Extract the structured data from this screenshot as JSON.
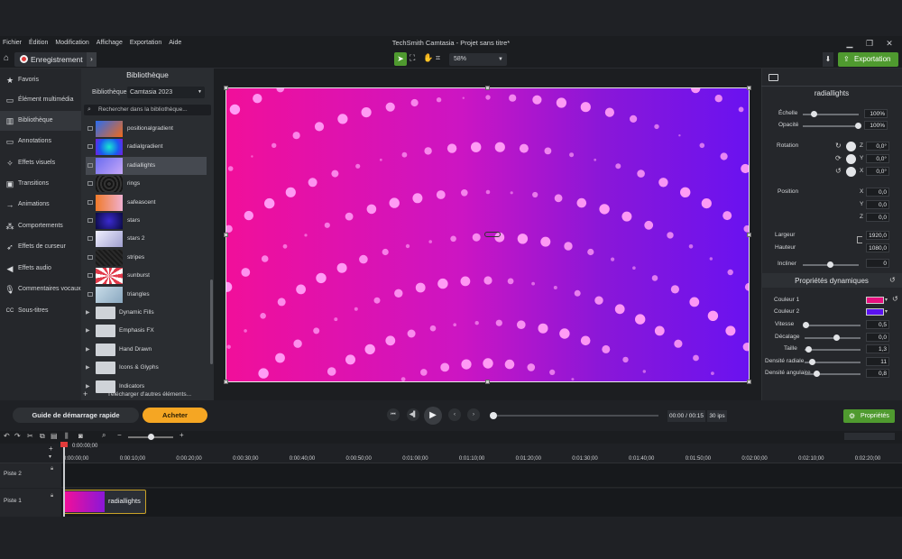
{
  "menubar": {
    "items": [
      "Fichier",
      "Édition",
      "Modification",
      "Affichage",
      "Exportation",
      "Aide"
    ],
    "app_title": "TechSmith Camtasia - Projet sans titre*"
  },
  "toolbar": {
    "record_label": "Enregistrement",
    "zoom_value": "58%",
    "export_label": "Exportation"
  },
  "nav": {
    "items": [
      {
        "label": "Favoris",
        "icon": "star-icon"
      },
      {
        "label": "Élément multimédia",
        "icon": "media-icon"
      },
      {
        "label": "Bibliothèque",
        "icon": "library-icon",
        "active": true
      },
      {
        "label": "Annotations",
        "icon": "annotation-icon"
      },
      {
        "label": "Effets visuels",
        "icon": "effects-icon"
      },
      {
        "label": "Transitions",
        "icon": "transition-icon"
      },
      {
        "label": "Animations",
        "icon": "animation-icon"
      },
      {
        "label": "Comportements",
        "icon": "behavior-icon"
      },
      {
        "label": "Effets de curseur",
        "icon": "cursor-icon"
      },
      {
        "label": "Effets audio",
        "icon": "audio-icon"
      },
      {
        "label": "Commentaires vocaux",
        "icon": "mic-icon"
      },
      {
        "label": "Sous-titres",
        "icon": "cc-icon"
      }
    ]
  },
  "library": {
    "title": "Bibliothèque",
    "select_label": "Bibliothèque",
    "select_value": "Camtasia 2023",
    "search_placeholder": "Rechercher dans la bibliothèque...",
    "assets": [
      {
        "name": "positionalgradient"
      },
      {
        "name": "radialgradient"
      },
      {
        "name": "radiallights",
        "selected": true
      },
      {
        "name": "rings"
      },
      {
        "name": "safeascent"
      },
      {
        "name": "stars"
      },
      {
        "name": "stars 2"
      },
      {
        "name": "stripes"
      },
      {
        "name": "sunburst"
      },
      {
        "name": "triangles"
      }
    ],
    "folders": [
      "Dynamic Fills",
      "Emphasis FX",
      "Hand Drawn",
      "Icons & Glyphs",
      "Indicators"
    ],
    "download_label": "Télécharger d'autres éléments..."
  },
  "properties": {
    "title": "radiallights",
    "scale_label": "Échelle",
    "scale_value": "100%",
    "scale_level": 1.0,
    "opacity_label": "Opacité",
    "opacity_value": "100%",
    "opacity_level": 1.0,
    "rotation_label": "Rotation",
    "rotation": [
      {
        "axis": "Z",
        "value": "0,0°"
      },
      {
        "axis": "Y",
        "value": "0,0°"
      },
      {
        "axis": "X",
        "value": "0,0°"
      }
    ],
    "position_label": "Position",
    "position": [
      {
        "axis": "X",
        "value": "0,0"
      },
      {
        "axis": "Y",
        "value": "0,0"
      },
      {
        "axis": "Z",
        "value": "0,0"
      }
    ],
    "width_label": "Largeur",
    "width_value": "1920,0",
    "height_label": "Hauteur",
    "height_value": "1080,0",
    "tilt_label": "Incliner",
    "tilt_value": "0",
    "dynamic_title": "Propriétés dynamiques",
    "color1_label": "Couleur 1",
    "color1": "#e8107f",
    "color2_label": "Couleur 2",
    "color2": "#5a12f0",
    "sliders": [
      {
        "label": "Vitesse",
        "value": "0,5"
      },
      {
        "label": "Décalage",
        "value": "0,0"
      },
      {
        "label": "Taille",
        "value": "1,3"
      },
      {
        "label": "Densité radiale",
        "value": "11"
      },
      {
        "label": "Densité angulaire",
        "value": "0,8"
      }
    ]
  },
  "transport": {
    "quickstart_label": "Guide de démarrage rapide",
    "buy_label": "Acheter",
    "time": "00:00 / 00:15",
    "fps": "30 ips",
    "props_label": "Propriétés"
  },
  "timeline": {
    "playhead_time": "0:00:00;00",
    "ticks": [
      "0:00:00;00",
      "0:00:10;00",
      "0:00:20;00",
      "0:00:30;00",
      "0:00:40;00",
      "0:00:50;00",
      "0:01:00;00",
      "0:01:10;00",
      "0:01:20;00",
      "0:01:30;00",
      "0:01:40;00",
      "0:01:50;00",
      "0:02:00;00",
      "0:02:10;00",
      "0:02:20;00"
    ],
    "track2_name": "Piste 2",
    "track1_name": "Piste 1",
    "clip_name": "radiallights"
  }
}
